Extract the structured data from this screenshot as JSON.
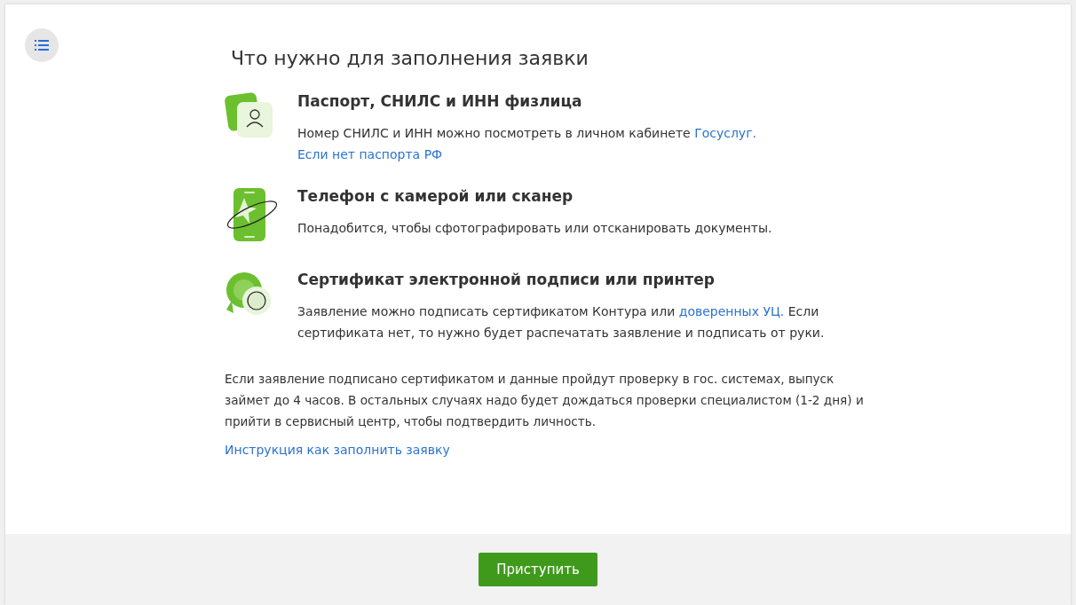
{
  "title": "Что нужно для заполнения заявки",
  "requirements": [
    {
      "kind": "passport",
      "heading": "Паспорт, СНИЛС и ИНН физлица",
      "description": [
        {
          "text": "Номер СНИЛС и ИНН можно посмотреть в личном кабинете ",
          "link": false
        },
        {
          "text": "Госуслуг.",
          "link": true
        }
      ],
      "extra_link": "Если нет паспорта РФ"
    },
    {
      "kind": "phone",
      "heading": "Телефон с камерой или сканер",
      "description": [
        {
          "text": "Понадобится, чтобы сфотографировать или отсканировать документы.",
          "link": false
        }
      ]
    },
    {
      "kind": "certificate",
      "heading": "Сертификат электронной подписи или принтер",
      "description": [
        {
          "text": "Заявление можно подписать сертификатом Контура или ",
          "link": false
        },
        {
          "text": "доверенных УЦ.",
          "link": true
        },
        {
          "text": " Если сертификата нет, то нужно будет распечатать заявление и подписать от руки.",
          "link": false
        }
      ]
    }
  ],
  "note": "Если заявление подписано сертификатом и данные пройдут проверку в гос. системах, выпуск займет до 4 часов. В остальных случаях надо будет дождаться проверки специалистом (1-2 дня) и прийти в сервисный центр, чтобы подтвердить личность.",
  "instruction_link": "Инструкция как заполнить заявку",
  "start_button": "Приступить"
}
